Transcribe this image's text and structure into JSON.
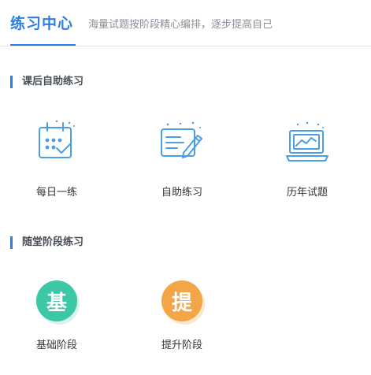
{
  "header": {
    "title": "练习中心",
    "subtitle": "海量试题按阶段精心编排，逐步提高自己"
  },
  "sections": [
    {
      "title": "课后自助练习",
      "items": [
        {
          "label": "每日一练",
          "icon": "calendar-check-icon"
        },
        {
          "label": "自助练习",
          "icon": "pen-writing-icon"
        },
        {
          "label": "历年试题",
          "icon": "laptop-chart-icon"
        }
      ]
    },
    {
      "title": "随堂阶段练习",
      "items": [
        {
          "label": "基础阶段",
          "badge": "基",
          "color": "#3cc8a6"
        },
        {
          "label": "提升阶段",
          "badge": "提",
          "color": "#f4a545"
        }
      ]
    }
  ],
  "colors": {
    "accent": "#2f7de1",
    "icon_blue": "#4a9ee8"
  }
}
